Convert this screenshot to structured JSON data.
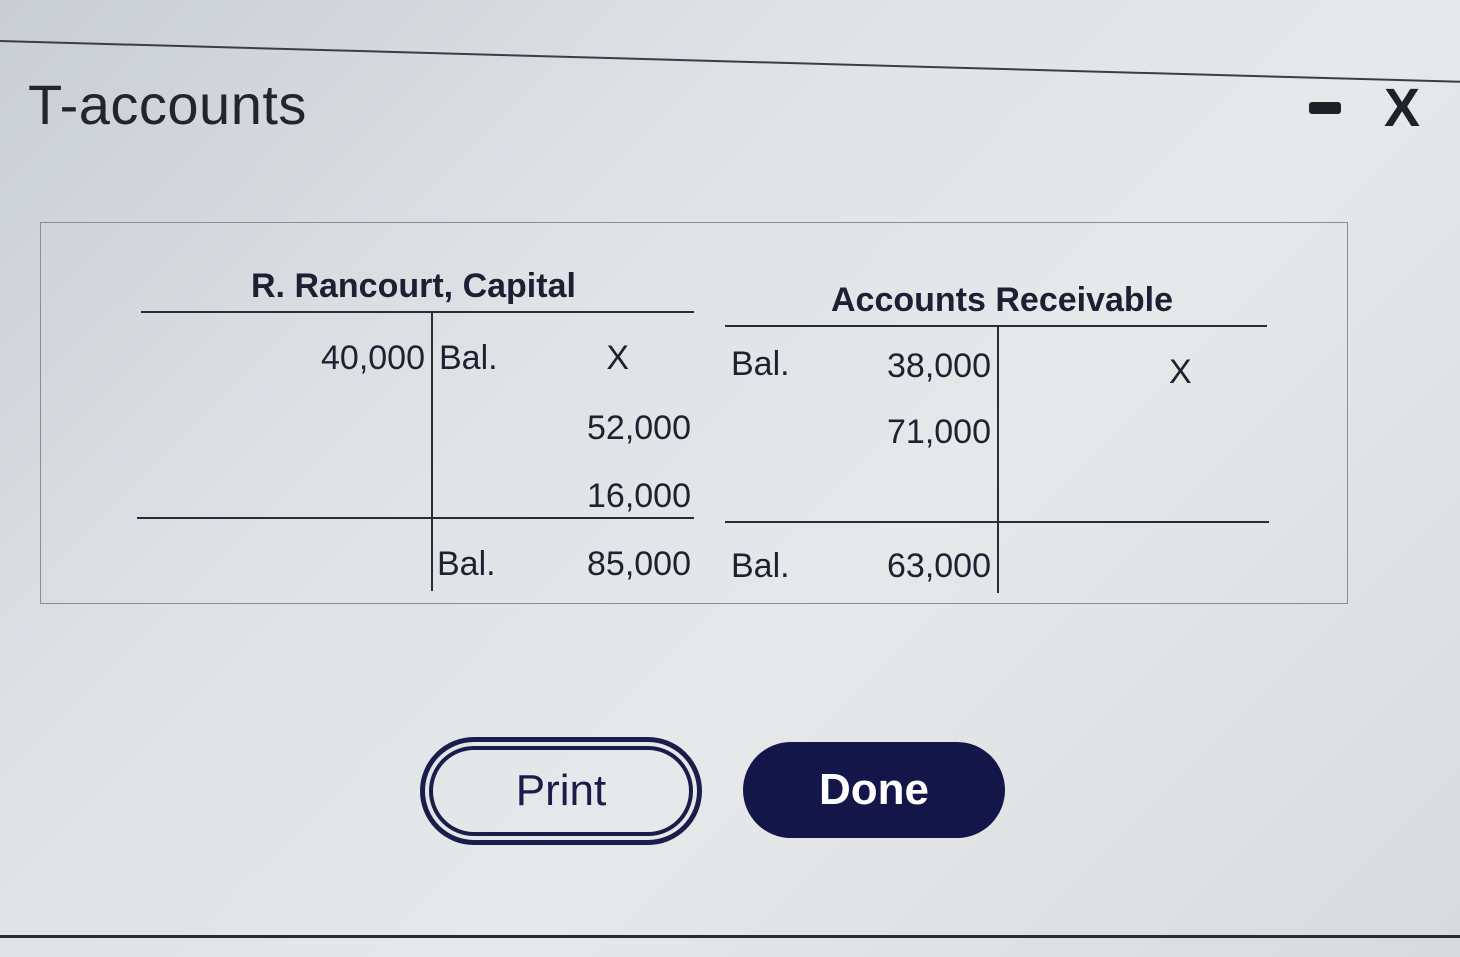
{
  "window": {
    "title": "T-accounts",
    "minimize_icon": "minimize-icon",
    "close_label": "X"
  },
  "accounts": [
    {
      "name": "R. Rancourt, Capital",
      "debits": [
        "40,000"
      ],
      "credits": [
        {
          "label": "Bal.",
          "amount": "X"
        },
        {
          "label": "",
          "amount": "52,000"
        },
        {
          "label": "",
          "amount": "16,000"
        }
      ],
      "ending_balance": {
        "side": "credit",
        "label": "Bal.",
        "amount": "85,000"
      }
    },
    {
      "name": "Accounts Receivable",
      "debits": [
        {
          "label": "Bal.",
          "amount": "38,000"
        },
        {
          "label": "",
          "amount": "71,000"
        }
      ],
      "credits": [
        "X"
      ],
      "ending_balance": {
        "side": "debit",
        "label": "Bal.",
        "amount": "63,000"
      }
    }
  ],
  "buttons": {
    "print": "Print",
    "done": "Done"
  }
}
